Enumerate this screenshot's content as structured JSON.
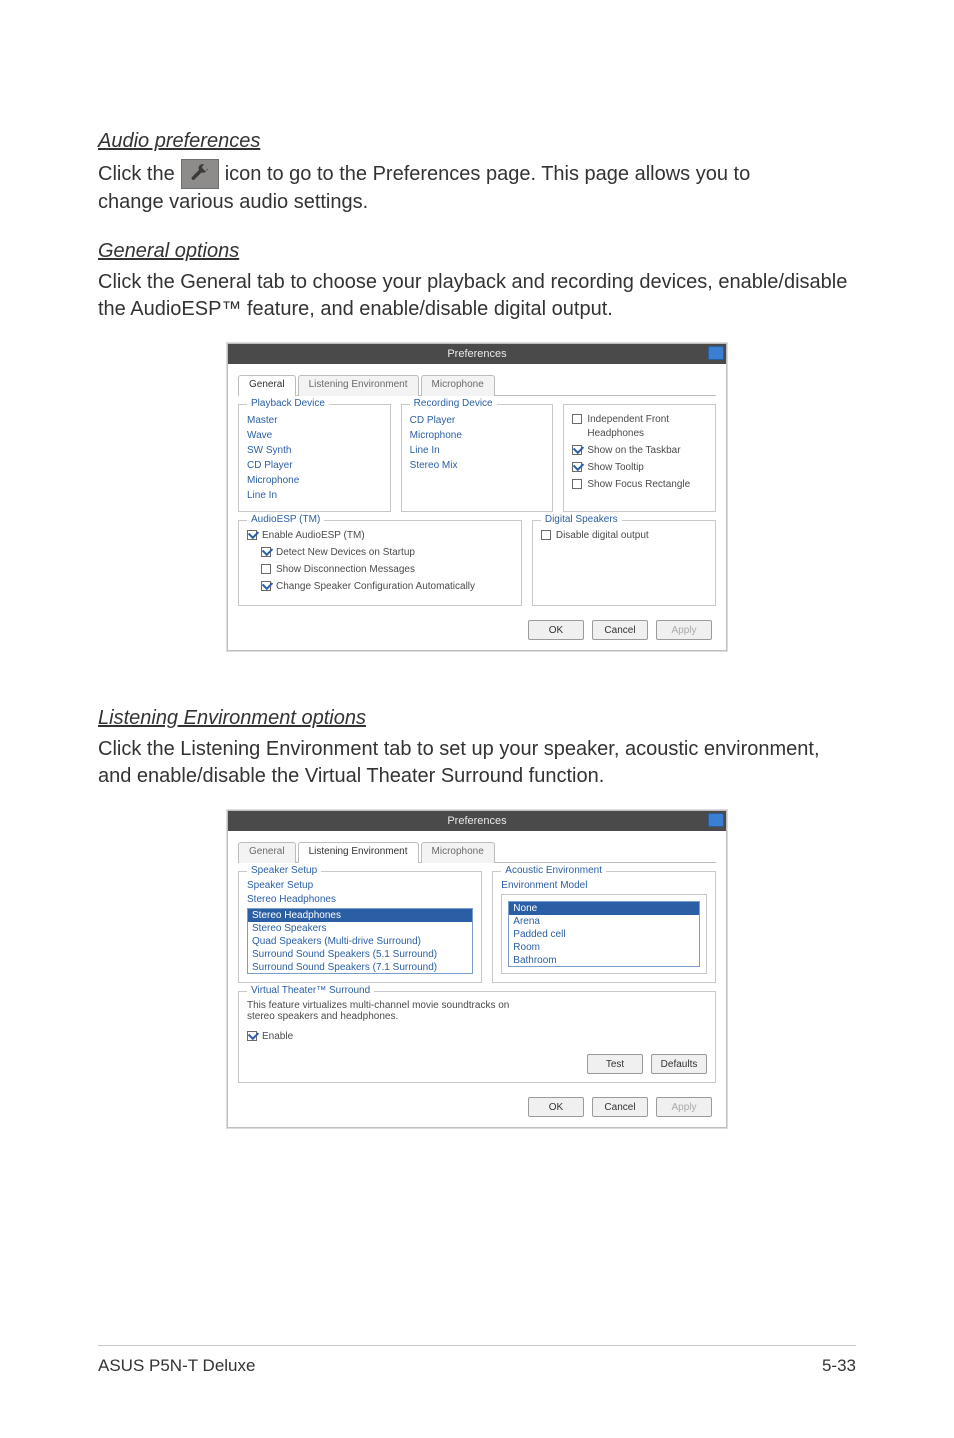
{
  "sections": {
    "audio_prefs": {
      "heading": "Audio preferences",
      "line1_before": "Click the",
      "line1_after": "icon to go to the Preferences page. This page allows you to",
      "line2": "change various audio settings."
    },
    "general_opts": {
      "heading": "General options",
      "body": "Click the General tab to choose your playback and recording devices, enable/disable the AudioESP™ feature, and enable/disable digital output."
    },
    "listening_env": {
      "heading": "Listening Environment options",
      "body": "Click the Listening Environment tab to set up your speaker, acoustic environment, and enable/disable the Virtual Theater Surround function."
    }
  },
  "window_common": {
    "title": "Preferences",
    "tabs": {
      "general": "General",
      "listening": "Listening Environment",
      "microphone": "Microphone"
    },
    "buttons": {
      "ok": "OK",
      "cancel": "Cancel",
      "apply": "Apply"
    }
  },
  "general_window": {
    "groups": {
      "playback": {
        "title": "Playback Device",
        "items": [
          "Master",
          "Wave",
          "SW Synth",
          "CD Player",
          "Microphone",
          "Line In"
        ]
      },
      "recording": {
        "title": "Recording Device",
        "items": [
          "CD Player",
          "Microphone",
          "Line In",
          "Stereo Mix"
        ]
      },
      "other_opts": {
        "o1": "Independent Front Headphones",
        "o2": "Show on the Taskbar",
        "o3": "Show Tooltip",
        "o4": "Show Focus Rectangle"
      },
      "audioesp": {
        "title": "AudioESP (TM)",
        "enable": "Enable AudioESP (TM)",
        "c1": "Detect New Devices on Startup",
        "c2": "Show Disconnection Messages",
        "c3": "Change Speaker Configuration Automatically"
      },
      "digital": {
        "title": "Digital Speakers",
        "c1": "Disable digital output"
      }
    }
  },
  "listening_window": {
    "speaker_setup": {
      "group_title": "Speaker Setup",
      "label": "Speaker Setup",
      "sub_label": "Stereo Headphones",
      "options": [
        "Stereo Headphones",
        "Stereo Speakers",
        "Quad Speakers (Multi-drive Surround)",
        "Surround Sound Speakers (5.1 Surround)",
        "Surround Sound Speakers (7.1 Surround)"
      ]
    },
    "acoustic_env": {
      "group_title": "Acoustic Environment",
      "label": "Environment Model",
      "options": [
        "None",
        "Arena",
        "Padded cell",
        "Room",
        "Bathroom"
      ]
    },
    "vts": {
      "group_title": "Virtual Theater™ Surround",
      "desc": "This feature virtualizes multi-channel movie soundtracks on stereo speakers and headphones.",
      "enable": "Enable"
    },
    "buttons": {
      "test": "Test",
      "defaults": "Defaults"
    }
  },
  "footer": {
    "left": "ASUS P5N-T Deluxe",
    "right": "5-33"
  }
}
